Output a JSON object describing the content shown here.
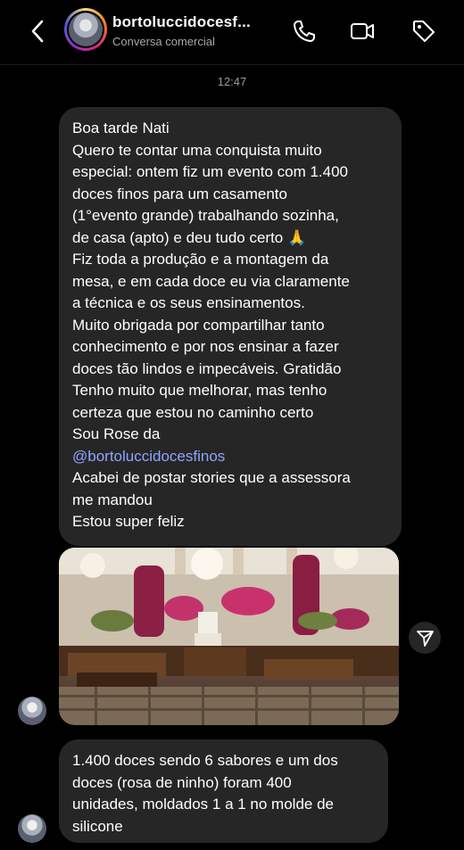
{
  "header": {
    "username": "bortoluccidocesf...",
    "subtitle": "Conversa comercial",
    "icons": [
      "back-icon",
      "phone-icon",
      "video-camera-icon",
      "tag-icon"
    ]
  },
  "timestamp": "12:47",
  "message1": {
    "lines": [
      "Boa tarde Nati",
      "Quero te contar uma conquista muito",
      "especial: ontem fiz um evento com 1.400",
      "doces finos para um casamento",
      "(1°evento grande) trabalhando sozinha,",
      "de casa (apto) e deu tudo certo 🙏",
      "Fiz toda a produção e a montagem da",
      "mesa, e em cada doce eu via claramente",
      "a técnica e os seus ensinamentos.",
      "Muito obrigada por compartilhar tanto",
      "conhecimento e por nos ensinar a fazer",
      "doces tão lindos e impecáveis. Gratidão",
      "Tenho muito que melhorar, mas tenho",
      "certeza que estou no caminho certo",
      "Sou Rose da"
    ],
    "mention": "@bortoluccidocesfinos",
    "lines_after": [
      "Acabei de postar stories que a assessora",
      "me mandou",
      "Estou super feliz"
    ]
  },
  "photo": {
    "description_icon": "event-photo"
  },
  "message2": {
    "lines": [
      "1.400 doces sendo 6 sabores e um dos",
      "doces (rosa de ninho) foram 400",
      "unidades, moldados 1 a 1 no molde de",
      "silicone"
    ]
  },
  "colors": {
    "background": "#000000",
    "bubble": "#262626",
    "mention": "#8fa4ff",
    "muted": "#a8a8a8"
  }
}
